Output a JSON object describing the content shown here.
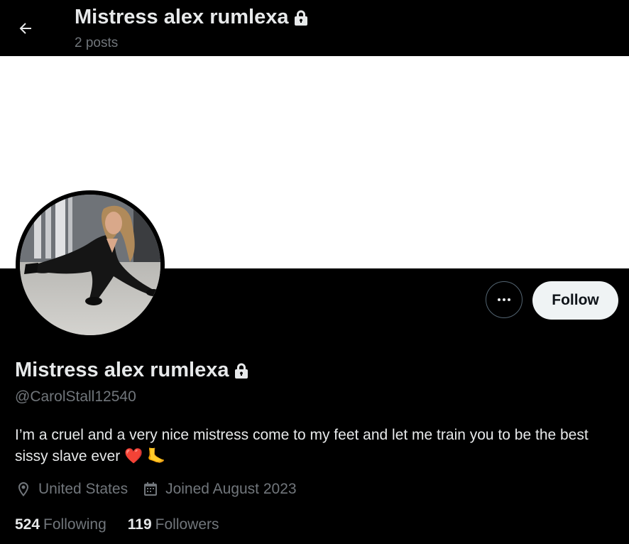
{
  "header": {
    "display_name": "Mistress alex rumlexa",
    "posts_count": "2 posts"
  },
  "profile": {
    "display_name": "Mistress alex rumlexa",
    "handle": "@CarolStall12540",
    "bio": "I’m a cruel and a very nice mistress come to my feet and let me train you to be the best sissy slave ever ❤️ 🦶",
    "location": "United States",
    "joined": "Joined August 2023",
    "following_count": "524",
    "following_label": "Following",
    "followers_count": "119",
    "followers_label": "Followers"
  },
  "actions": {
    "follow_label": "Follow"
  },
  "icons": {
    "back": "arrow-left-icon",
    "lock": "lock-icon",
    "more": "more-horizontal-icon",
    "location": "location-pin-icon",
    "calendar": "calendar-icon"
  },
  "colors": {
    "background": "#000000",
    "banner": "#ffffff",
    "primary_text": "#e7e9ea",
    "secondary_text": "#71767b",
    "follow_button_bg": "#eff3f4",
    "follow_button_text": "#0f1419"
  }
}
